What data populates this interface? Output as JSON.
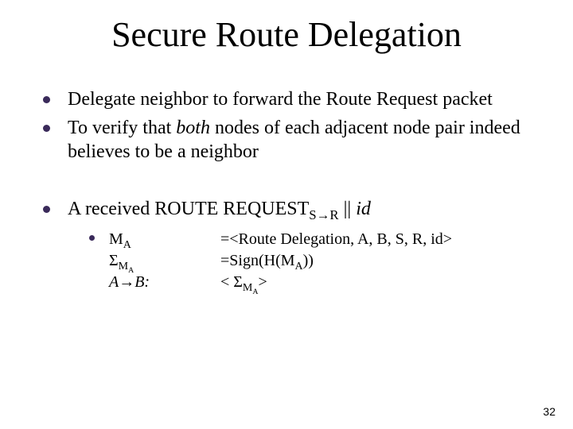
{
  "title": "Secure Route Delegation",
  "bullets": {
    "b1": "Delegate neighbor to forward the Route Request packet",
    "b2_pre": "To verify that ",
    "b2_em": "both",
    "b2_post": " nodes of each adjacent node pair indeed believes to be a neighbor",
    "b3_pre": "A received ROUTE REQUEST",
    "b3_sub_s": "S",
    "b3_sub_arrow": "→",
    "b3_sub_r": "R",
    "b3_mid": " || ",
    "b3_id": "id"
  },
  "defs": {
    "l1_left_m": "M",
    "l1_left_a": "A",
    "l1_right": "=<Route Delegation, A, B, S, R, id>",
    "l2_left_sigma": "Σ",
    "l2_left_m": "M",
    "l2_left_a": "A",
    "l2_right_pre": "=Sign(H(M",
    "l2_right_a": "A",
    "l2_right_post": "))",
    "l3_left_a": "A",
    "l3_left_arrow": "→",
    "l3_left_b": "B:",
    "l3_right_pre": "< Σ",
    "l3_right_m": "M",
    "l3_right_a": "A",
    "l3_right_post": ">"
  },
  "page_number": "32"
}
